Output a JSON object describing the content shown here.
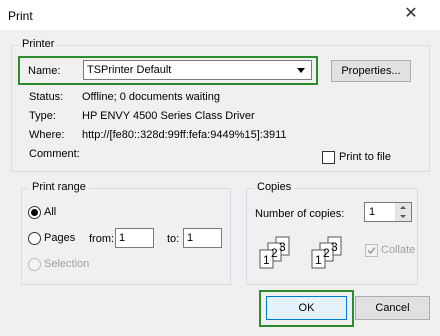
{
  "window": {
    "title": "Print",
    "close_glyph": "✕"
  },
  "printer": {
    "group_label": "Printer",
    "name_label": "Name:",
    "name_value": "TSPrinter Default",
    "properties_label": "Properties...",
    "status_label": "Status:",
    "status_value": "Offline; 0 documents waiting",
    "type_label": "Type:",
    "type_value": "HP ENVY 4500 Series Class Driver",
    "where_label": "Where:",
    "where_value": "http://[fe80::328d:99ff:fefa:9449%15]:3911",
    "comment_label": "Comment:",
    "print_to_file_label": "Print to file",
    "print_to_file_checked": false
  },
  "print_range": {
    "group_label": "Print range",
    "all_label": "All",
    "pages_label": "Pages",
    "from_label": "from:",
    "from_value": "1",
    "to_label": "to:",
    "to_value": "1",
    "selection_label": "Selection",
    "selected": "All"
  },
  "copies": {
    "group_label": "Copies",
    "number_label": "Number of copies:",
    "number_value": "1",
    "collate_label": "Collate",
    "collate_checked": true,
    "collate_icon_digits": [
      "1",
      "2",
      "3"
    ]
  },
  "buttons": {
    "ok_label": "OK",
    "cancel_label": "Cancel"
  },
  "colors": {
    "highlight_box": "#2e8b2e",
    "window_bg": "#f0f0f0"
  }
}
